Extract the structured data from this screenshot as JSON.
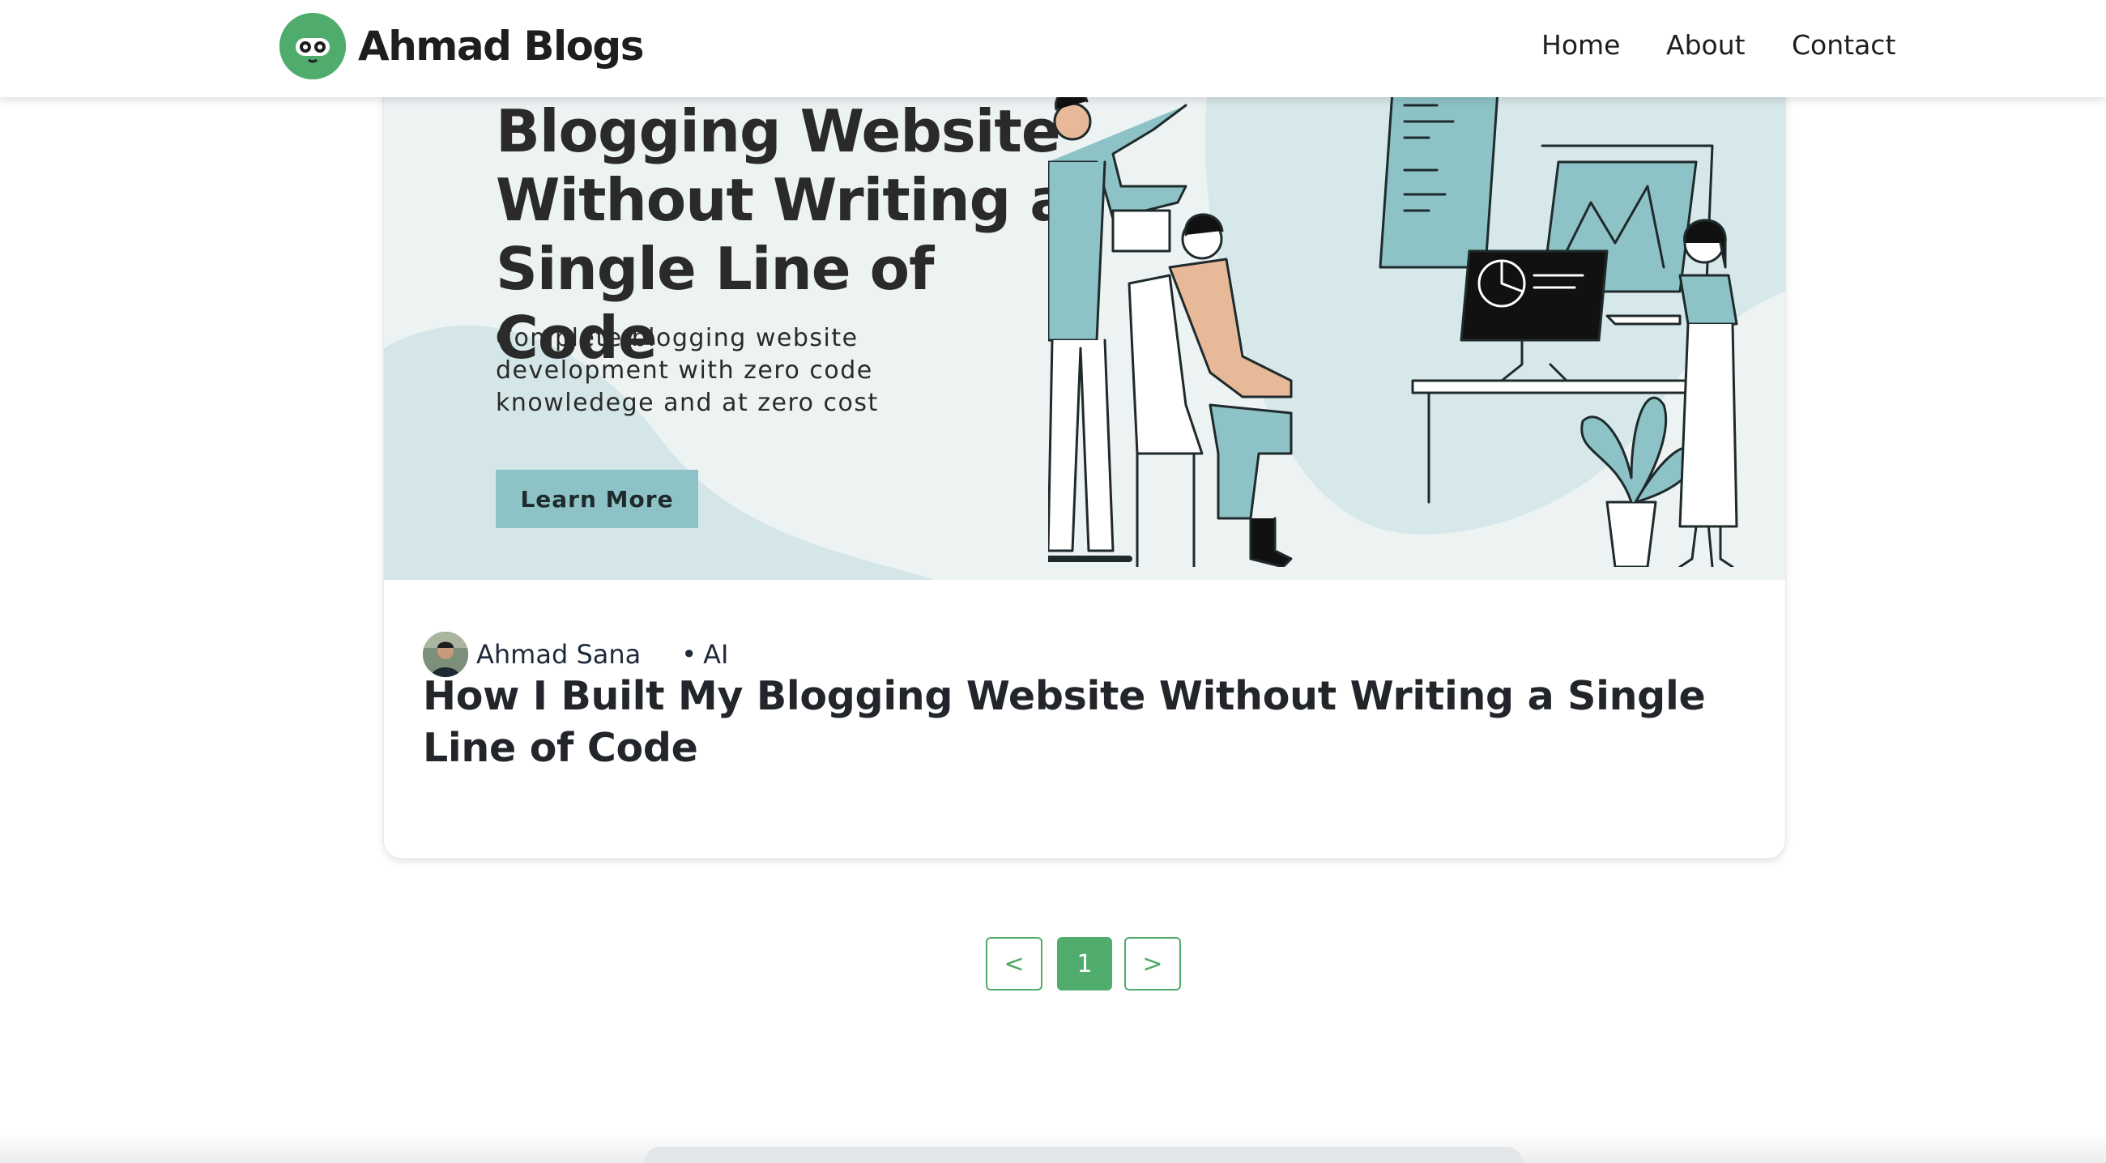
{
  "header": {
    "brand": "Ahmad Blogs",
    "nav": [
      "Home",
      "About",
      "Contact"
    ]
  },
  "post": {
    "banner": {
      "title_lines": [
        "Blogging Website",
        "Without Writing a",
        "Single Line of Code"
      ],
      "subtitle_lines": [
        "Complete blogging website",
        "development with zero code",
        "knowledege and at zero cost"
      ],
      "button": "Learn More"
    },
    "author": "Ahmad Sana",
    "category": "AI",
    "bullet": "•",
    "title": "How I Built My Blogging Website Without Writing a Single Line of Code"
  },
  "pagination": {
    "prev": "<",
    "current": "1",
    "next": ">"
  },
  "colors": {
    "brand_green": "#4fac6c",
    "banner_teal": "#8dc3c6",
    "banner_bg": "#edf2f3"
  }
}
